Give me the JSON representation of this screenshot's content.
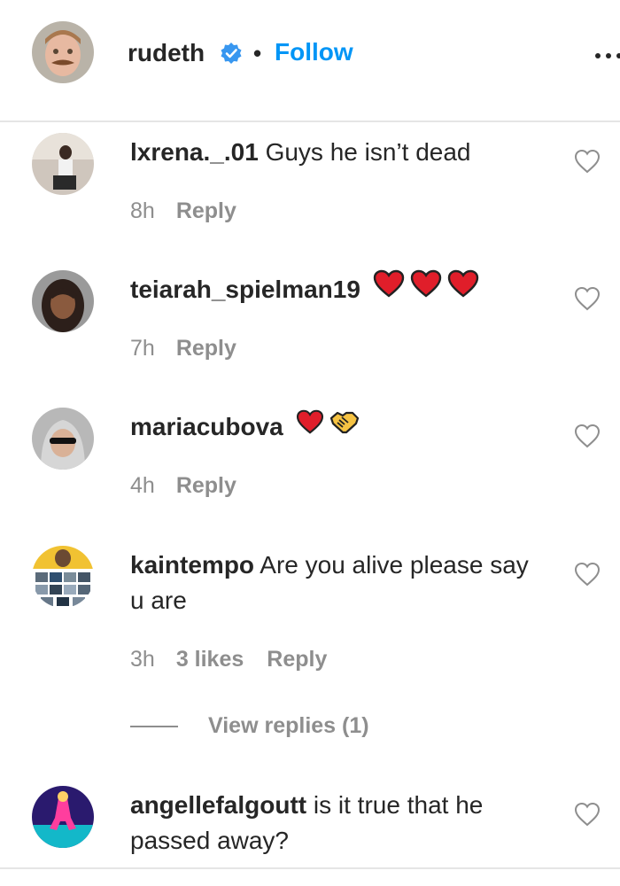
{
  "header": {
    "username": "rudeth",
    "verified_icon": "verified-badge-icon",
    "separator": "•",
    "follow_label": "Follow",
    "more_icon": "more-options-icon",
    "accent_color": "#0095f6"
  },
  "comments": [
    {
      "username": "lxrena._.01",
      "text": "Guys he isn’t dead",
      "time": "8h",
      "reply_label": "Reply",
      "emojis": []
    },
    {
      "username": "teiarah_spielman19",
      "text": "",
      "time": "7h",
      "reply_label": "Reply",
      "emojis": [
        "red-heart",
        "red-heart",
        "red-heart"
      ]
    },
    {
      "username": "mariacubova",
      "text": "",
      "time": "4h",
      "reply_label": "Reply",
      "emojis": [
        "red-heart",
        "handshake"
      ]
    },
    {
      "username": "kaintempo",
      "text": "Are you alive please say u are",
      "time": "3h",
      "likes": "3 likes",
      "reply_label": "Reply",
      "view_replies": "View replies (1)",
      "emojis": []
    },
    {
      "username": "angellefalgoutt",
      "text": "is it true that he passed away?",
      "time": "",
      "reply_label": "",
      "emojis": []
    }
  ],
  "icons": {
    "like": "heart-outline-icon"
  }
}
